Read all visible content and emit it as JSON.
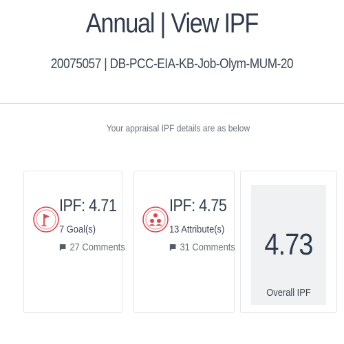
{
  "header": {
    "title": "Annual | View IPF",
    "subtitle": "20075057 | DB-PCC-EIA-KB-Job-Olym-MUM-20"
  },
  "intro": "Your appraisal IPF details are as below",
  "cards": {
    "goals": {
      "icon": "flag-icon",
      "ipf": "IPF: 4.71",
      "count": "7 Goal(s)",
      "comments": "27 Comments"
    },
    "attributes": {
      "icon": "people-icon",
      "ipf": "IPF: 4.75",
      "count": "13 Attribute(s)",
      "comments": "31 Comments"
    },
    "overall": {
      "value": "4.73",
      "label": "Overall IPF"
    }
  },
  "colors": {
    "accent": "#e0444c",
    "text": "#2f3b4c",
    "muted": "#6c7480",
    "overall_bg": "#f0f1f2"
  }
}
